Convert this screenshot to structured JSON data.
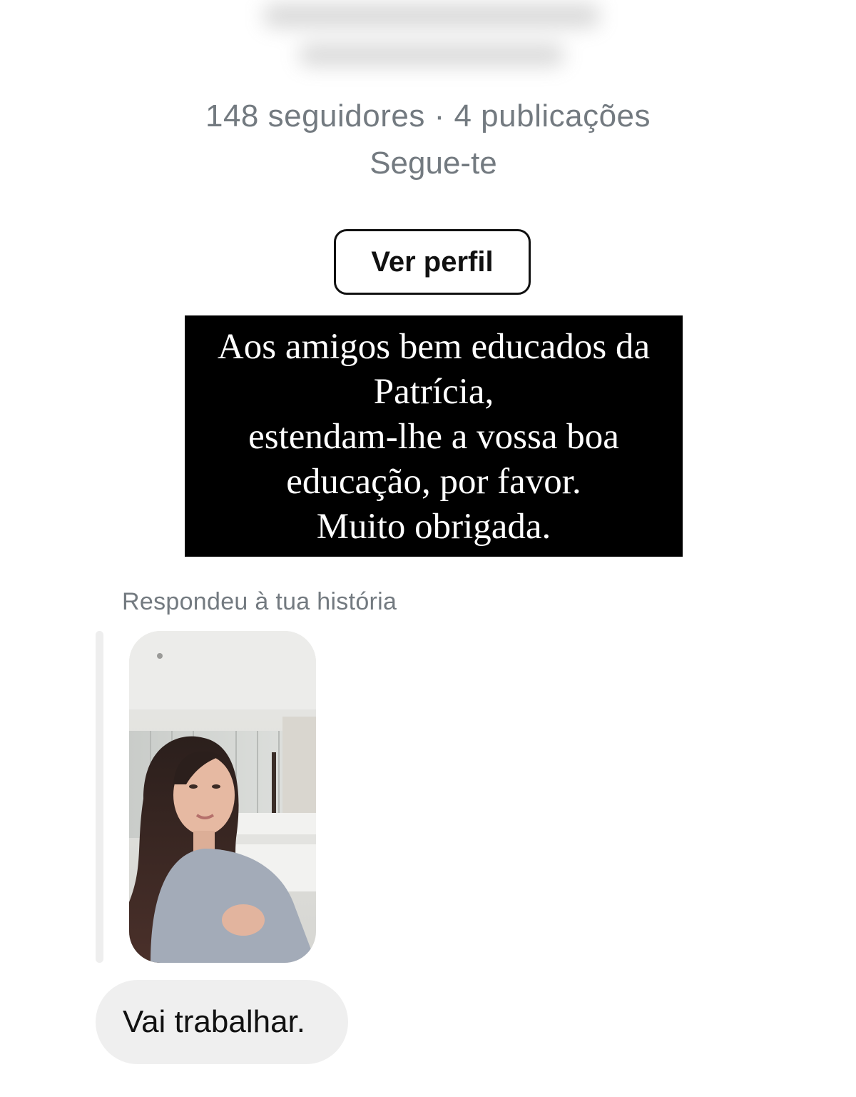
{
  "profile": {
    "stats": "148 seguidores · 4 publicações",
    "follows_you": "Segue-te",
    "view_profile_label": "Ver perfil"
  },
  "notice": {
    "lines": [
      "Aos amigos bem educados da",
      "Patrícia,",
      "estendam-lhe a vossa boa",
      "educação, por favor.",
      "Muito obrigada."
    ]
  },
  "conversation": {
    "reply_label": "Respondeu à tua história",
    "story_thumbnail_icon": "story-photo",
    "message_text": "Vai trabalhar."
  },
  "colors": {
    "secondary_text": "#737a80",
    "bubble_bg": "#efefef",
    "notice_bg": "#000000"
  }
}
